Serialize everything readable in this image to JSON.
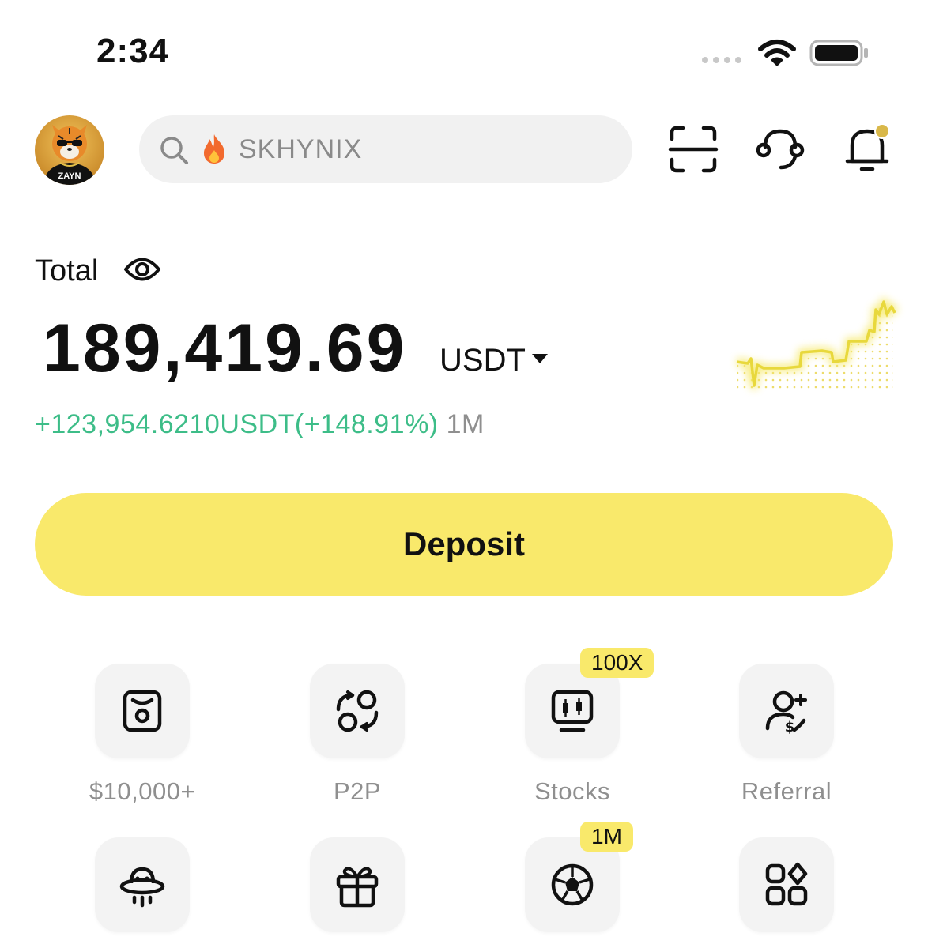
{
  "status_bar": {
    "time": "2:34"
  },
  "search": {
    "placeholder": "SKHYNIX"
  },
  "avatar": {
    "text": "ZAYN"
  },
  "total": {
    "label": "Total",
    "balance": "189,419.69",
    "currency": "USDT",
    "pnl": "+123,954.6210USDT(+148.91%)",
    "period": "1M"
  },
  "deposit": {
    "label": "Deposit"
  },
  "shortcuts": [
    {
      "label": "$10,000+",
      "icon": "vault-icon"
    },
    {
      "label": "P2P",
      "icon": "p2p-exchange-icon"
    },
    {
      "label": "Stocks",
      "icon": "stocks-monitor-icon",
      "badge": "100X"
    },
    {
      "label": "Referral",
      "icon": "referral-user-icon"
    },
    {
      "label": "",
      "icon": "ufo-icon"
    },
    {
      "label": "",
      "icon": "gift-icon"
    },
    {
      "label": "",
      "icon": "soccer-ball-icon",
      "badge": "1M"
    },
    {
      "label": "",
      "icon": "more-apps-icon"
    }
  ],
  "colors": {
    "accent": "#f9e96b",
    "gain": "#3dbd88",
    "muted": "#8f8f8f",
    "bell_dot": "#d9b84a"
  }
}
